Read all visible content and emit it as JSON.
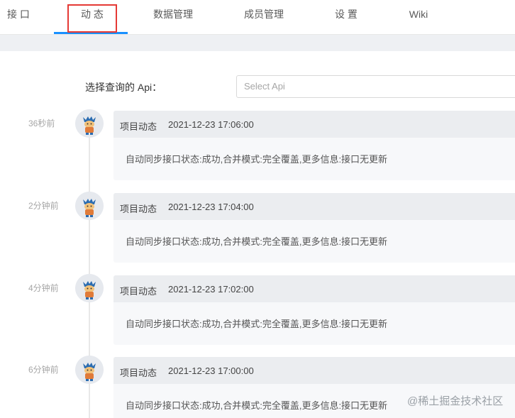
{
  "tabs": [
    {
      "label": "接 口"
    },
    {
      "label": "动 态"
    },
    {
      "label": "数据管理"
    },
    {
      "label": "成员管理"
    },
    {
      "label": "设 置"
    },
    {
      "label": "Wiki"
    }
  ],
  "api_filter": {
    "label": "选择查询的 Api：",
    "placeholder": "Select Api"
  },
  "entries": [
    {
      "relative_time": "36秒前",
      "type": "项目动态",
      "datetime": "2021-12-23 17:06:00",
      "content": "自动同步接口状态:成功,合并模式:完全覆盖,更多信息:接口无更新"
    },
    {
      "relative_time": "2分钟前",
      "type": "项目动态",
      "datetime": "2021-12-23 17:04:00",
      "content": "自动同步接口状态:成功,合并模式:完全覆盖,更多信息:接口无更新"
    },
    {
      "relative_time": "4分钟前",
      "type": "项目动态",
      "datetime": "2021-12-23 17:02:00",
      "content": "自动同步接口状态:成功,合并模式:完全覆盖,更多信息:接口无更新"
    },
    {
      "relative_time": "6分钟前",
      "type": "项目动态",
      "datetime": "2021-12-23 17:00:00",
      "content": "自动同步接口状态:成功,合并模式:完全覆盖,更多信息:接口无更新"
    }
  ],
  "watermark": "@稀土掘金技术社区",
  "colors": {
    "active_tab_ink": "#1890ff",
    "highlight_box": "#e53935"
  }
}
